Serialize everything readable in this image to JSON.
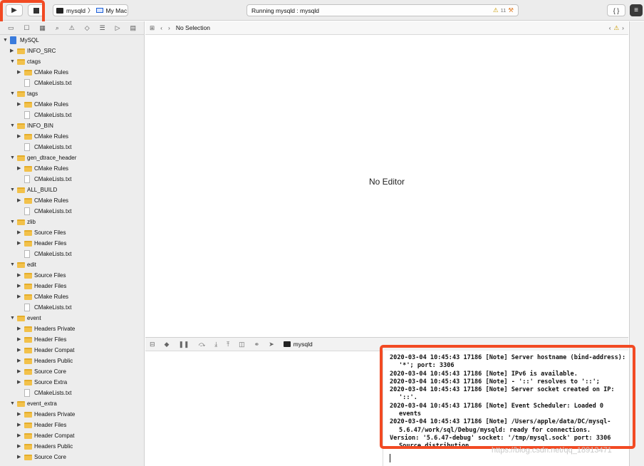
{
  "toolbar": {
    "scheme_name": "mysqld",
    "destination": "My Mac",
    "status_text": "Running mysqld : mysqld",
    "warning_count": "11",
    "library_label": "{ }"
  },
  "navigator": {
    "items": [
      {
        "label": "MySQL",
        "depth": 0,
        "kind": "project",
        "open": true
      },
      {
        "label": "INFO_SRC",
        "depth": 1,
        "kind": "folder",
        "open": false
      },
      {
        "label": "ctags",
        "depth": 1,
        "kind": "folder",
        "open": true
      },
      {
        "label": "CMake Rules",
        "depth": 2,
        "kind": "folder",
        "open": false
      },
      {
        "label": "CMakeLists.txt",
        "depth": 2,
        "kind": "file"
      },
      {
        "label": "tags",
        "depth": 1,
        "kind": "folder",
        "open": true
      },
      {
        "label": "CMake Rules",
        "depth": 2,
        "kind": "folder",
        "open": false
      },
      {
        "label": "CMakeLists.txt",
        "depth": 2,
        "kind": "file"
      },
      {
        "label": "INFO_BIN",
        "depth": 1,
        "kind": "folder",
        "open": true
      },
      {
        "label": "CMake Rules",
        "depth": 2,
        "kind": "folder",
        "open": false
      },
      {
        "label": "CMakeLists.txt",
        "depth": 2,
        "kind": "file"
      },
      {
        "label": "gen_dtrace_header",
        "depth": 1,
        "kind": "folder",
        "open": true
      },
      {
        "label": "CMake Rules",
        "depth": 2,
        "kind": "folder",
        "open": false
      },
      {
        "label": "CMakeLists.txt",
        "depth": 2,
        "kind": "file"
      },
      {
        "label": "ALL_BUILD",
        "depth": 1,
        "kind": "folder",
        "open": true
      },
      {
        "label": "CMake Rules",
        "depth": 2,
        "kind": "folder",
        "open": false
      },
      {
        "label": "CMakeLists.txt",
        "depth": 2,
        "kind": "file"
      },
      {
        "label": "zlib",
        "depth": 1,
        "kind": "folder",
        "open": true
      },
      {
        "label": "Source Files",
        "depth": 2,
        "kind": "folder",
        "open": false
      },
      {
        "label": "Header Files",
        "depth": 2,
        "kind": "folder",
        "open": false
      },
      {
        "label": "CMakeLists.txt",
        "depth": 2,
        "kind": "file"
      },
      {
        "label": "edit",
        "depth": 1,
        "kind": "folder",
        "open": true
      },
      {
        "label": "Source Files",
        "depth": 2,
        "kind": "folder",
        "open": false
      },
      {
        "label": "Header Files",
        "depth": 2,
        "kind": "folder",
        "open": false
      },
      {
        "label": "CMake Rules",
        "depth": 2,
        "kind": "folder",
        "open": false
      },
      {
        "label": "CMakeLists.txt",
        "depth": 2,
        "kind": "file"
      },
      {
        "label": "event",
        "depth": 1,
        "kind": "folder",
        "open": true
      },
      {
        "label": "Headers Private",
        "depth": 2,
        "kind": "folder",
        "open": false
      },
      {
        "label": "Header Files",
        "depth": 2,
        "kind": "folder",
        "open": false
      },
      {
        "label": "Header Compat",
        "depth": 2,
        "kind": "folder",
        "open": false
      },
      {
        "label": "Headers Public",
        "depth": 2,
        "kind": "folder",
        "open": false
      },
      {
        "label": "Source Core",
        "depth": 2,
        "kind": "folder",
        "open": false
      },
      {
        "label": "Source Extra",
        "depth": 2,
        "kind": "folder",
        "open": false
      },
      {
        "label": "CMakeLists.txt",
        "depth": 2,
        "kind": "file"
      },
      {
        "label": "event_extra",
        "depth": 1,
        "kind": "folder",
        "open": true
      },
      {
        "label": "Headers Private",
        "depth": 2,
        "kind": "folder",
        "open": false
      },
      {
        "label": "Header Files",
        "depth": 2,
        "kind": "folder",
        "open": false
      },
      {
        "label": "Header Compat",
        "depth": 2,
        "kind": "folder",
        "open": false
      },
      {
        "label": "Headers Public",
        "depth": 2,
        "kind": "folder",
        "open": false
      },
      {
        "label": "Source Core",
        "depth": 2,
        "kind": "folder",
        "open": false
      }
    ]
  },
  "editor": {
    "jump_bar_text": "No Selection",
    "placeholder": "No Editor"
  },
  "debug_bar": {
    "process_name": "mysqld"
  },
  "console": {
    "lines": [
      "2020-03-04 10:45:43 17186 [Note] Server hostname (bind-address): '*'; port: 3306",
      "2020-03-04 10:45:43 17186 [Note] IPv6 is available.",
      "2020-03-04 10:45:43 17186 [Note]   - '::' resolves to '::';",
      "2020-03-04 10:45:43 17186 [Note] Server socket created on IP: '::'.",
      "2020-03-04 10:45:43 17186 [Note] Event Scheduler: Loaded 0 events",
      "2020-03-04 10:45:43 17186 [Note] /Users/apple/data/DC/mysql-5.6.47/work/sql/Debug/mysqld: ready for connections.",
      "Version: '5.6.47-debug'  socket: '/tmp/mysql.sock'  port: 3306  Source distribution"
    ]
  },
  "watermark": "https://blog.csdn.net/qq_18913471",
  "colors": {
    "highlight": "#f24a23",
    "folder": "#f2c14b",
    "accent": "#3a7bdc",
    "warning": "#c99a00"
  }
}
